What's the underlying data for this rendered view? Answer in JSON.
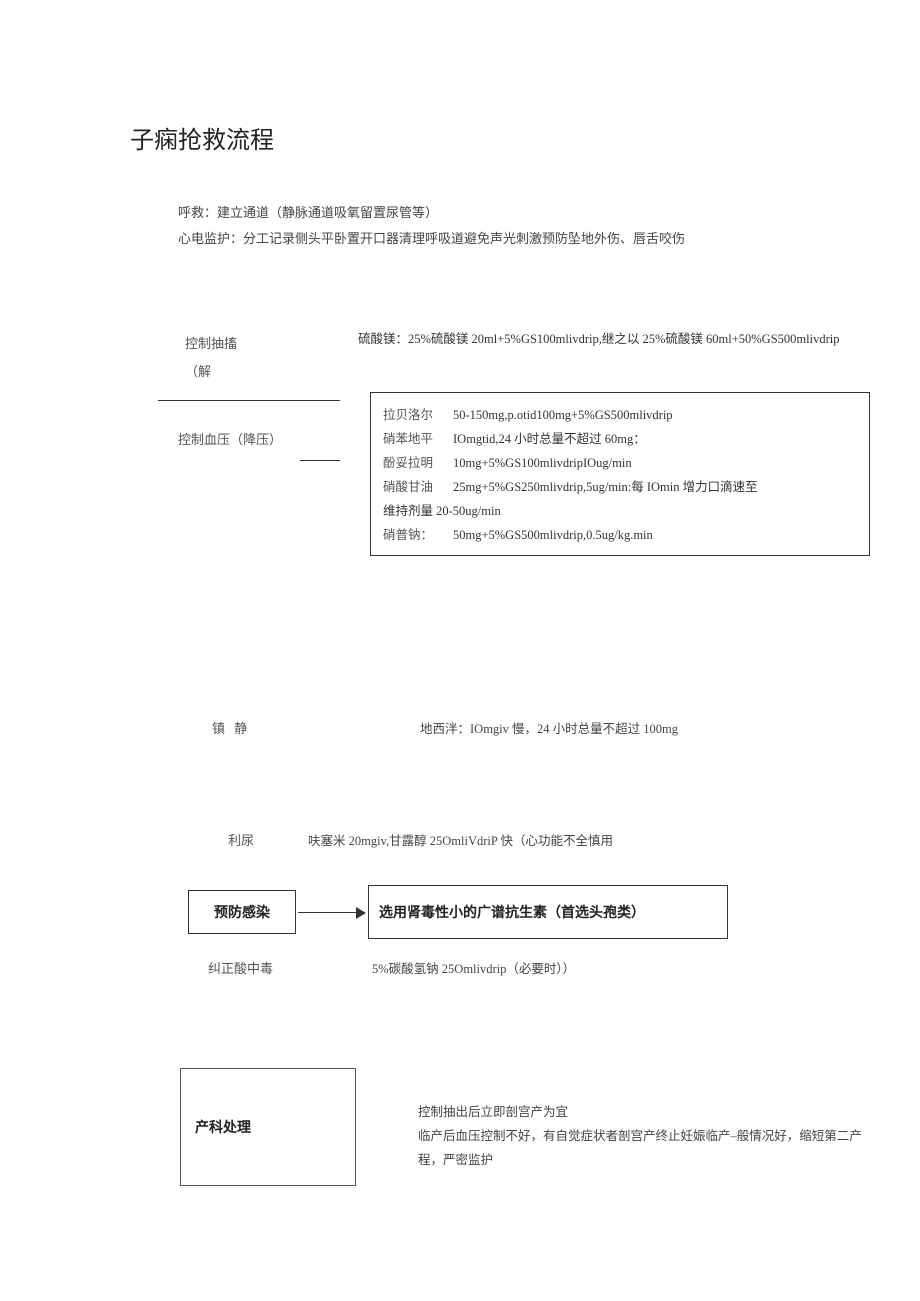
{
  "title": "子痫抢救流程",
  "intro": {
    "line1": "呼救：建立通道（静脉通道吸氧留置尿管等）",
    "line2": "心电监护：分工记录侧头平卧置开口器清理呼吸道避免声光刺激预防坠地外伤、唇舌咬伤"
  },
  "sections": {
    "convulsion": {
      "label1": "控制抽搐",
      "label2": "（解",
      "text": "硫酸镁：25%硫酸镁 20ml+5%GS100mlivdrip,继之以 25%硫酸镁 60ml+50%GS500mlivdrip"
    },
    "bp": {
      "label": "控制血压（降压）",
      "rows": [
        {
          "name": "拉贝洛尔",
          "val": "50-150mg,p.otid100mg+5%GS500mlivdrip"
        },
        {
          "name": "硝苯地平",
          "val": "IOmgtid,24 小时总量不超过 60mg："
        },
        {
          "name": "酚妥拉明",
          "val": "10mg+5%GS100mlivdripIOug/min"
        },
        {
          "name": "硝酸甘油",
          "val": "25mg+5%GS250mlivdrip,5ug/min:每 IOmin 增力口滴速至"
        }
      ],
      "maintain": "维持剂量 20-50ug/min",
      "last": {
        "name": "硝普钠：",
        "val": "50mg+5%GS500mlivdrip,0.5ug/kg.min"
      }
    },
    "sedation": {
      "label": "镇 静",
      "text": "地西泮：IOmgiv 慢，24 小时总量不超过 100mg"
    },
    "diuresis": {
      "label": "利尿",
      "text": "呋塞米 20mgiv,甘露醇 25OmliVdriP 快（心功能不全慎用"
    },
    "infection": {
      "label": "预防感染",
      "text": "选用肾毒性小的广谱抗生素（首选头孢类）"
    },
    "acidosis": {
      "label": "纠正酸中毒",
      "text": "5%碳酸氢钠 25Omlivdrip（必要时））"
    },
    "obstetric": {
      "label": "产科处理",
      "line1": "控制抽出后立即剖宫产为宜",
      "line2": "临产后血压控制不好，有自觉症状者剖宫产终止妊娠临产–般情况好，缩短第二产程，严密监护"
    }
  }
}
